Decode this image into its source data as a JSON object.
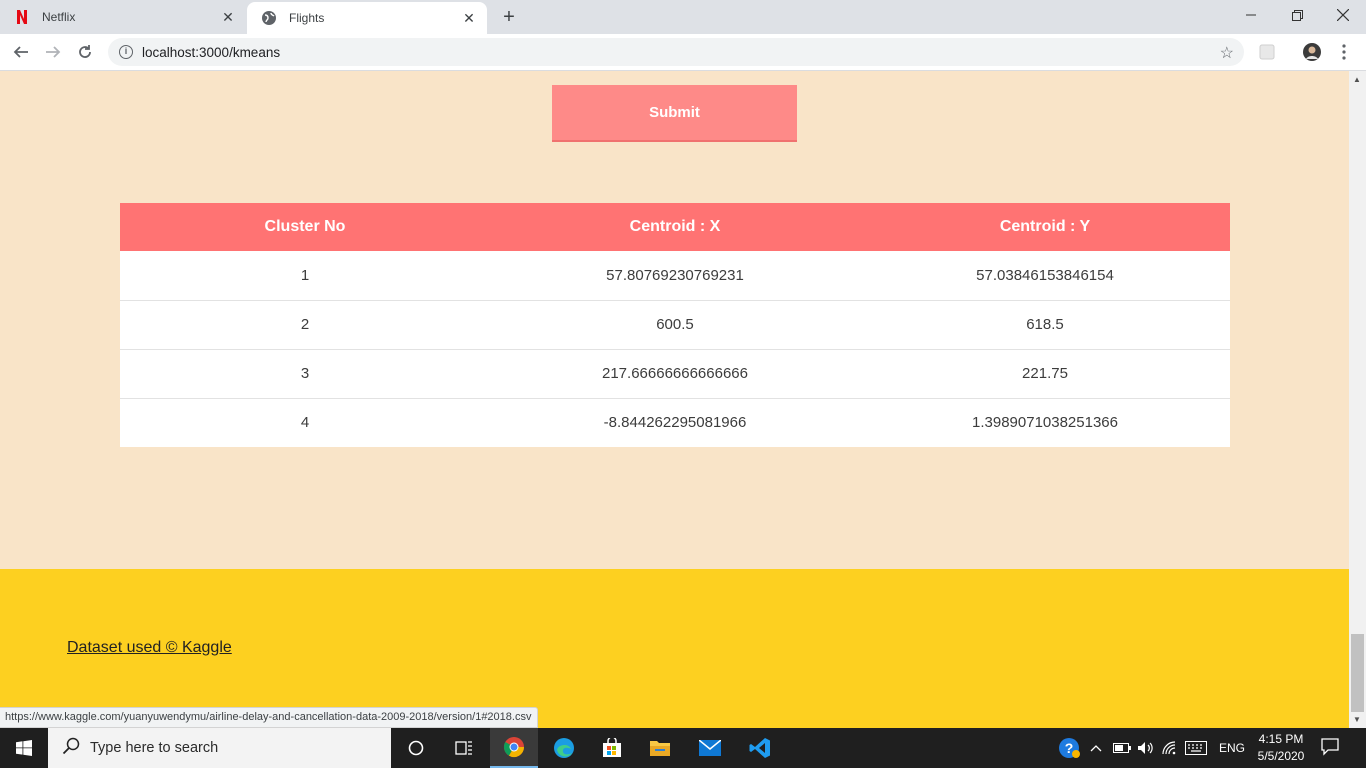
{
  "browser": {
    "tabs": [
      {
        "title": "Netflix",
        "active": false
      },
      {
        "title": "Flights",
        "active": true
      }
    ],
    "address_url": "localhost:3000/kmeans",
    "status_url": "https://www.kaggle.com/yuanyuwendymu/airline-delay-and-cancellation-data-2009-2018/version/1#2018.csv"
  },
  "page": {
    "submit_label": "Submit",
    "table": {
      "headers": [
        "Cluster No",
        "Centroid : X",
        "Centroid : Y"
      ],
      "rows": [
        [
          "1",
          "57.80769230769231",
          "57.03846153846154"
        ],
        [
          "2",
          "600.5",
          "618.5"
        ],
        [
          "3",
          "217.66666666666666",
          "221.75"
        ],
        [
          "4",
          "-8.844262295081966",
          "1.3989071038251366"
        ]
      ]
    },
    "footer_link": "Dataset used © Kaggle"
  },
  "taskbar": {
    "search_placeholder": "Type here to search",
    "language": "ENG",
    "time": "4:15 PM",
    "date": "5/5/2020"
  },
  "colors": {
    "page_bg": "#f9e4c8",
    "submit_bg": "#fe8a88",
    "table_header_bg": "#ff7373",
    "footer_bg": "#fdd020"
  }
}
